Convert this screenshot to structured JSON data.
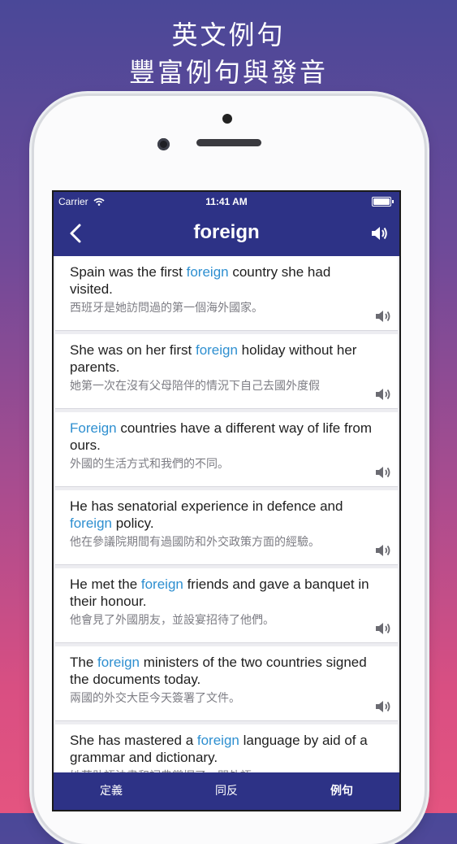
{
  "promo": {
    "line1": "英文例句",
    "line2": "豐富例句與發音"
  },
  "status_bar": {
    "carrier": "Carrier",
    "time": "11:41 AM"
  },
  "nav": {
    "title": "foreign",
    "back_icon": "chevron-left-icon",
    "speaker_icon": "speaker-icon"
  },
  "examples": [
    {
      "pre": "Spain was the first ",
      "word": "foreign",
      "post": " country she had visited.",
      "zh": "西班牙是她訪問過的第一個海外國家。"
    },
    {
      "pre": "She was on her first ",
      "word": "foreign",
      "post": " holiday without her parents.",
      "zh": "她第一次在沒有父母陪伴的情況下自己去國外度假"
    },
    {
      "pre": "",
      "word": "Foreign",
      "post": " countries have a different way of life from ours.",
      "zh": "外國的生活方式和我們的不同。"
    },
    {
      "pre": "He has senatorial experience in defence and ",
      "word": "foreign",
      "post": " policy.",
      "zh": "他在參議院期間有過國防和外交政策方面的經驗。"
    },
    {
      "pre": "He met the ",
      "word": "foreign",
      "post": " friends and gave a banquet in their honour.",
      "zh": "他會見了外國朋友，並設宴招待了他們。"
    },
    {
      "pre": "The ",
      "word": "foreign",
      "post": " ministers of the two countries signed the documents today.",
      "zh": "兩國的外交大臣今天簽署了文件。"
    },
    {
      "pre": "She has mastered a ",
      "word": "foreign",
      "post": " language by aid of a grammar and dictionary.",
      "zh": "她藉助語法書和詞典掌握了一門外語。"
    }
  ],
  "tabs": [
    {
      "label": "定義",
      "active": false
    },
    {
      "label": "同反",
      "active": false
    },
    {
      "label": "例句",
      "active": true
    }
  ],
  "colors": {
    "nav_bg": "#2d3286",
    "highlight": "#2e8fd0"
  }
}
